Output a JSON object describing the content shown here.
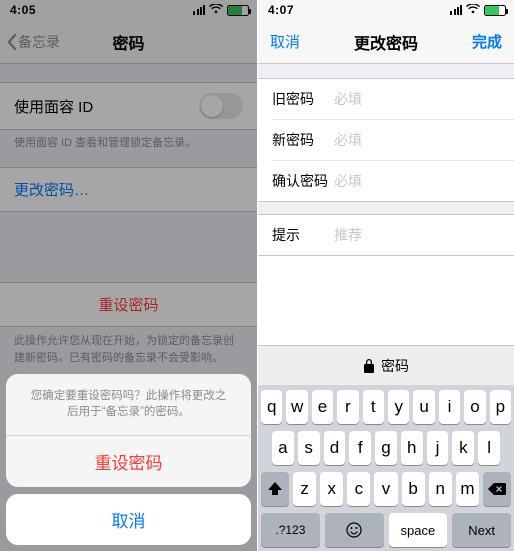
{
  "left": {
    "status": {
      "time": "4:05"
    },
    "nav": {
      "back": "备忘录",
      "title": "密码"
    },
    "faceid": {
      "label": "使用面容 ID",
      "footer": "使用面容 ID 查看和管理锁定备忘录。"
    },
    "change": "更改密码…",
    "reset": {
      "button": "重设密码",
      "footer": "此操作允许您从现在开始，为锁定的备忘录创建新密码。已有密码的备忘录不会受影响。"
    },
    "sheet": {
      "message": "您确定要重设密码吗？此操作将更改之后用于“备忘录”的密码。",
      "destructive": "重设密码",
      "cancel": "取消"
    }
  },
  "right": {
    "status": {
      "time": "4:07"
    },
    "nav": {
      "cancel": "取消",
      "title": "更改密码",
      "done": "完成"
    },
    "form": {
      "old": {
        "label": "旧密码",
        "placeholder": "必填"
      },
      "new": {
        "label": "新密码",
        "placeholder": "必填"
      },
      "confirm": {
        "label": "确认密码",
        "placeholder": "必填"
      },
      "hint": {
        "label": "提示",
        "placeholder": "推荐"
      }
    },
    "autofill": "密码",
    "keyboard": {
      "r1": [
        "q",
        "w",
        "e",
        "r",
        "t",
        "y",
        "u",
        "i",
        "o",
        "p"
      ],
      "r2": [
        "a",
        "s",
        "d",
        "f",
        "g",
        "h",
        "j",
        "k",
        "l"
      ],
      "r3": [
        "z",
        "x",
        "c",
        "v",
        "b",
        "n",
        "m"
      ],
      "numbers": ".?123",
      "space": "space",
      "next": "Next"
    }
  }
}
